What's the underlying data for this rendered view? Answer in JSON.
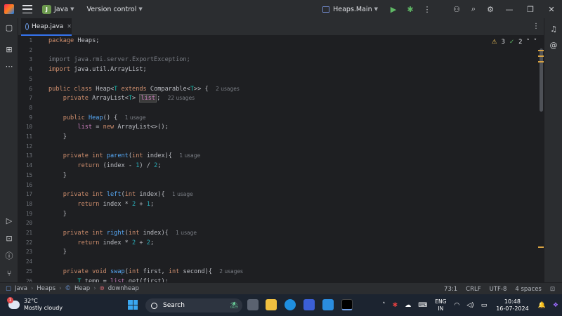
{
  "titlebar": {
    "project_badge": "J",
    "project_name": "Java",
    "vcs_label": "Version control",
    "run_config": "Heaps.Main"
  },
  "tab": {
    "label": "Heap.java"
  },
  "inspections": {
    "warnings": "3",
    "ok": "2"
  },
  "code_lines": [
    {
      "n": "1",
      "html": "<span class='kw'>package</span> Heaps;"
    },
    {
      "n": "2",
      "html": ""
    },
    {
      "n": "3",
      "html": "<span class='cm'>import java.rmi.server.ExportException;</span>"
    },
    {
      "n": "4",
      "html": "<span class='kw'>import</span> java.util.ArrayList;"
    },
    {
      "n": "5",
      "html": ""
    },
    {
      "n": "6",
      "html": "<span class='kw'>public class</span> Heap&lt;<span class='tp'>T</span> <span class='kw'>extends</span> Comparable&lt;<span class='tp'>T</span>&gt;&gt; {  <span class='hint'>2 usages</span>"
    },
    {
      "n": "7",
      "html": "    <span class='kw'>private</span> ArrayList&lt;<span class='tp'>T</span>&gt; <span class='fld hl'>list</span>;  <span class='hint'>22 usages</span>"
    },
    {
      "n": "8",
      "html": ""
    },
    {
      "n": "9",
      "html": "    <span class='kw'>public</span> <span class='fn'>Heap</span>() {  <span class='hint'>1 usage</span>"
    },
    {
      "n": "10",
      "html": "        <span class='fld'>list</span> = <span class='kw'>new</span> ArrayList&lt;&gt;();"
    },
    {
      "n": "11",
      "html": "    }"
    },
    {
      "n": "12",
      "html": ""
    },
    {
      "n": "13",
      "html": "    <span class='kw'>private int</span> <span class='fn'>parent</span>(<span class='kw'>int</span> index){  <span class='hint'>1 usage</span>"
    },
    {
      "n": "14",
      "html": "        <span class='kw'>return</span> (index - <span class='num'>1</span>) / <span class='num'>2</span>;"
    },
    {
      "n": "15",
      "html": "    }"
    },
    {
      "n": "16",
      "html": ""
    },
    {
      "n": "17",
      "html": "    <span class='kw'>private int</span> <span class='fn'>left</span>(<span class='kw'>int</span> index){  <span class='hint'>1 usage</span>"
    },
    {
      "n": "18",
      "html": "        <span class='kw'>return</span> index * <span class='num'>2</span> + <span class='num'>1</span>;"
    },
    {
      "n": "19",
      "html": "    }"
    },
    {
      "n": "20",
      "html": ""
    },
    {
      "n": "21",
      "html": "    <span class='kw'>private int</span> <span class='fn'>right</span>(<span class='kw'>int</span> index){  <span class='hint'>1 usage</span>"
    },
    {
      "n": "22",
      "html": "        <span class='kw'>return</span> index * <span class='num'>2</span> + <span class='num'>2</span>;"
    },
    {
      "n": "23",
      "html": "    }"
    },
    {
      "n": "24",
      "html": ""
    },
    {
      "n": "25",
      "html": "    <span class='kw'>private void</span> <span class='fn'>swap</span>(<span class='kw'>int</span> first, <span class='kw'>int</span> second){  <span class='hint'>2 usages</span>"
    },
    {
      "n": "26",
      "html": "        <span class='tp'>T</span> temp = <span class='fld'>list</span>.get(first);"
    }
  ],
  "statusbar": {
    "crumbs": [
      "Java",
      "Heaps",
      "Heap",
      "downheap"
    ],
    "position": "73:1",
    "line_sep": "CRLF",
    "encoding": "UTF-8",
    "indent": "4 spaces"
  },
  "taskbar": {
    "temp": "32°C",
    "weather": "Mostly cloudy",
    "weather_badge": "1",
    "search_label": "Search",
    "lang_top": "ENG",
    "lang_bottom": "IN",
    "time": "10:48",
    "date": "16-07-2024"
  }
}
